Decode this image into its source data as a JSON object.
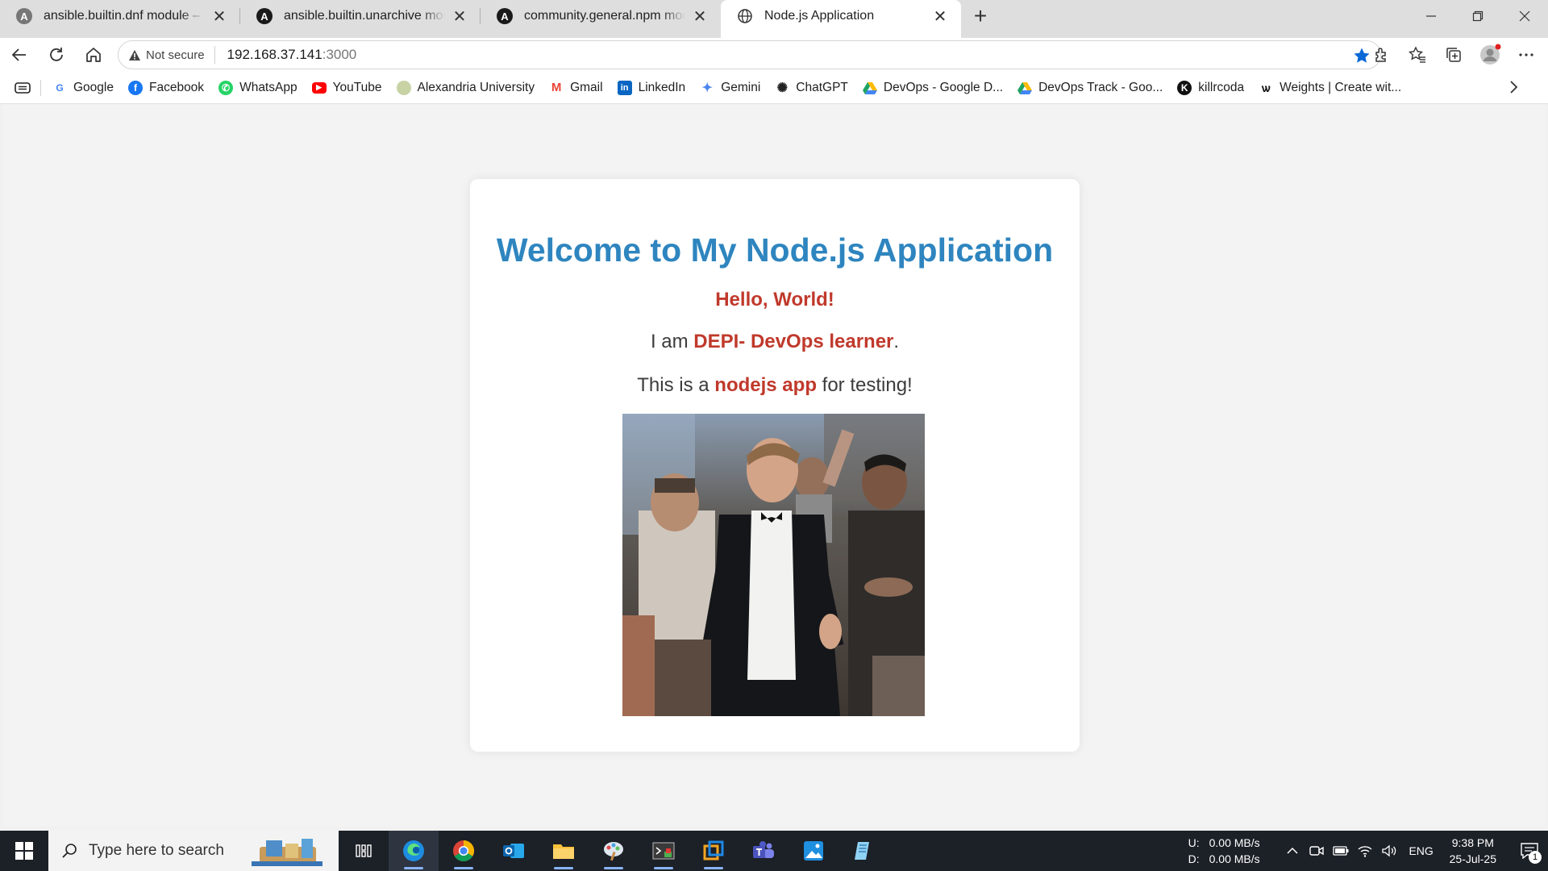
{
  "browser": {
    "tabs": [
      {
        "title": "ansible.builtin.dnf module – Manage packages with the dnf package manager",
        "icon": "ansible-icon",
        "active": false
      },
      {
        "title": "ansible.builtin.unarchive module – Unpacks an archive",
        "icon": "ansible-icon",
        "active": false
      },
      {
        "title": "community.general.npm module – Manage node.js packages with npm",
        "icon": "ansible-icon",
        "active": false
      },
      {
        "title": "Node.js Application",
        "icon": "globe-icon",
        "active": true
      }
    ],
    "security_label": "Not secure",
    "url_host": "192.168.37.141",
    "url_port": ":3000"
  },
  "bookmarks": [
    {
      "label": "Google",
      "icon": "google-icon",
      "color": "#4285f4"
    },
    {
      "label": "Facebook",
      "icon": "facebook-icon",
      "color": "#1877f2"
    },
    {
      "label": "WhatsApp",
      "icon": "whatsapp-icon",
      "color": "#25d366"
    },
    {
      "label": "YouTube",
      "icon": "youtube-icon",
      "color": "#ff0000"
    },
    {
      "label": "Alexandria University",
      "icon": "alexandria-university-icon",
      "color": "#8a9a5b"
    },
    {
      "label": "Gmail",
      "icon": "gmail-icon",
      "color": "#ea4335"
    },
    {
      "label": "LinkedIn",
      "icon": "linkedin-icon",
      "color": "#0a66c2"
    },
    {
      "label": "Gemini",
      "icon": "gemini-icon",
      "color": "#4e86f0"
    },
    {
      "label": "ChatGPT",
      "icon": "chatgpt-icon",
      "color": "#222222"
    },
    {
      "label": "DevOps  - Google D...",
      "icon": "google-drive-icon",
      "color": "#1fa463"
    },
    {
      "label": "DevOps Track - Goo...",
      "icon": "google-drive-icon",
      "color": "#1fa463"
    },
    {
      "label": "killrcoda",
      "icon": "killercoda-icon",
      "color": "#111111"
    },
    {
      "label": "Weights | Create wit...",
      "icon": "weights-icon",
      "color": "#111111"
    }
  ],
  "page": {
    "heading": "Welcome to My Node.js Application",
    "greeting": "Hello, World!",
    "line1_prefix": "I am ",
    "line1_bold": "DEPI- DevOps learner",
    "line1_suffix": ".",
    "line2_prefix": "This is a ",
    "line2_bold": "nodejs app",
    "line2_suffix": " for testing!",
    "colors": {
      "heading": "#2e85bf",
      "accent": "#c0392b",
      "text": "#3c3c3c"
    }
  },
  "taskbar": {
    "search_placeholder": "Type here to search",
    "apps": [
      "task-view-icon",
      "edge-icon",
      "chrome-icon",
      "outlook-icon",
      "file-explorer-icon",
      "paint-icon",
      "terminal-icon",
      "vmware-icon",
      "teams-icon",
      "photos-icon",
      "notepad-icon"
    ],
    "net_up_label": "U:",
    "net_up_value": "0.00 MB/s",
    "net_down_label": "D:",
    "net_down_value": "0.00 MB/s",
    "language": "ENG",
    "time": "9:38 PM",
    "date": "25-Jul-25",
    "notification_count": "1"
  }
}
